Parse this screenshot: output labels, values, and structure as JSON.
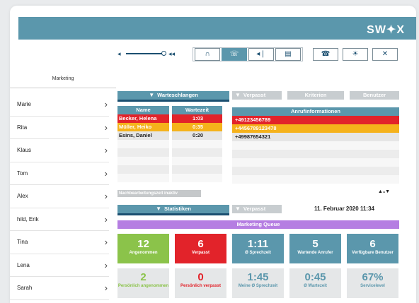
{
  "brand": {
    "logo": "SW✦X"
  },
  "toolbar": {
    "vol_left": "◂ ",
    "vol_right": "◂◂",
    "btn_headset": "∩",
    "btn_phone": "☏",
    "btn_mic": "◂❘",
    "btn_notes": "▤",
    "btn_call2": "☎",
    "btn_spy": "☀",
    "btn_mute": "✕"
  },
  "tabs": {
    "marketing": "Marketing"
  },
  "agents": [
    {
      "name": "Marie"
    },
    {
      "name": "Rita"
    },
    {
      "name": "Klaus"
    },
    {
      "name": "Tom"
    },
    {
      "name": "Alex"
    },
    {
      "name": "hild, Erik"
    },
    {
      "name": "Tina"
    },
    {
      "name": "Lena"
    },
    {
      "name": "Sarah"
    }
  ],
  "queue": {
    "title": "Warteschlangen",
    "col_name": "Name",
    "col_wait": "Wartezeit",
    "rows": [
      {
        "name": "Becker, Helena",
        "wait": "1:03"
      },
      {
        "name": "Müller, Heiko",
        "wait": "0:35"
      },
      {
        "name": "Esins, Daniel",
        "wait": "0:20"
      }
    ],
    "post_processing": "Nachbearbeitungszeit inaktiv"
  },
  "missed_tabs": {
    "missed": "Verpasst",
    "criteria": "Kriterien",
    "user": "Benutzer"
  },
  "call_info": {
    "header": "Anrufinformationen",
    "rows": [
      "+49123456789",
      "+4456789123478",
      "+49987654321"
    ],
    "pager": "▲₃▼"
  },
  "stats": {
    "title": "Statistiken",
    "missed_tab": "Verpasst",
    "date": "11. Februar 2020",
    "time": "11:34",
    "queue_name": "Marketing Queue",
    "top": [
      {
        "value": "12",
        "label": "Angenommen"
      },
      {
        "value": "6",
        "label": "Verpasst"
      },
      {
        "value": "1:11",
        "label": "Ø Sprechzeit"
      },
      {
        "value": "5",
        "label": "Wartende Anrufer"
      },
      {
        "value": "6",
        "label": "Verfügbare Benutzer"
      }
    ],
    "bottom": [
      {
        "value": "2",
        "label": "Persönlich angenommen"
      },
      {
        "value": "0",
        "label": "Persönlich verpasst"
      },
      {
        "value": "1:45",
        "label": "Meine Ø Sprechzeit"
      },
      {
        "value": "0:45",
        "label": "Ø Wartezeit"
      },
      {
        "value": "67%",
        "label": "Servicelevel"
      }
    ]
  },
  "colors": {
    "teal": "#5b97ac",
    "navy": "#1b4f70",
    "red": "#e2232a",
    "yellow": "#f5b21b",
    "green": "#8bc34a",
    "purple": "#b57ee2"
  }
}
